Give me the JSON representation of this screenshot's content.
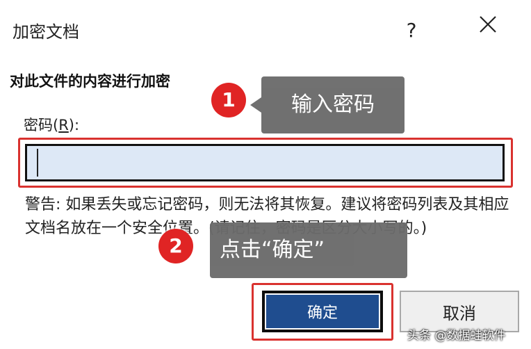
{
  "dialog": {
    "title": "加密文档",
    "help_label": "?",
    "heading": "对此文件的内容进行加密",
    "password_label_prefix": "密码(",
    "password_label_key": "R",
    "password_label_suffix": "):",
    "password_value": "",
    "warning": "警告: 如果丢失或忘记密码，则无法将其恢复。建议将密码列表及其相应文档名放在一个安全位置。(请记住，密码是区分大小写的。)",
    "ok_label": "确定",
    "cancel_label": "取消"
  },
  "callouts": [
    {
      "number": "1",
      "text": "输入密码"
    },
    {
      "number": "2",
      "text": "点击“确定”"
    }
  ],
  "watermark": "头条 @数据蛙软件",
  "colors": {
    "highlight": "#d9322f",
    "badge": "#e02424",
    "ok_button": "#1f4d8f",
    "input_bg": "#dde8f6",
    "callout_bg": "#6b6b6b"
  },
  "icons": {
    "close": "close-icon"
  }
}
